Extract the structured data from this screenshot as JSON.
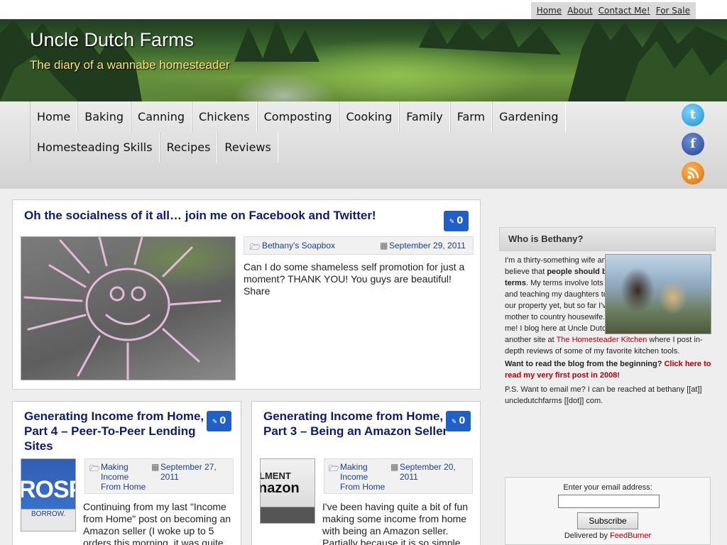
{
  "topnav": {
    "links": [
      "Home",
      "About",
      "Contact Me!",
      "For Sale"
    ]
  },
  "header": {
    "title": "Uncle Dutch Farms",
    "tagline": "The diary of a wannabe homesteader"
  },
  "nav": {
    "items": [
      "Home",
      "Baking",
      "Canning",
      "Chickens",
      "Composting",
      "Cooking",
      "Family",
      "Farm",
      "Gardening",
      "Homesteading Skills",
      "Recipes",
      "Reviews"
    ]
  },
  "social": {
    "icons": [
      "twitter-icon",
      "facebook-icon",
      "rss-icon"
    ]
  },
  "posts": [
    {
      "title": "Oh the socialness of it all… join me on Facebook and Twitter!",
      "comments": "0",
      "category": "Bethany's Soapbox",
      "date": "September 29, 2011",
      "excerpt": "Can I do some shameless self promotion for just a moment?    THANK YOU!  You guys are beautiful! Share"
    },
    {
      "title": "Generating Income from Home, Part 4 – Peer-To-Peer Lending Sites",
      "comments": "0",
      "category": "Making Income From Home",
      "date": "September 27, 2011",
      "thumb_text": "ROSP",
      "thumb_text2": "BORROW.",
      "excerpt": "Continuing from my last \"Income from Home\" post on becoming an Amazon seller (I woke up to 5 orders this morning, it was quite nice), we'll talk"
    },
    {
      "title": "Generating Income from Home, Part 3 – Being an Amazon Seller",
      "comments": "0",
      "category": "Making Income From Home",
      "date": "September 20, 2011",
      "thumb_text": "LMENT",
      "thumb_text2": "nazon",
      "excerpt": "I've been having quite a bit of fun making some income from home with being an Amazon seller. Partially because it is so simple and it takes"
    }
  ],
  "sidebar": {
    "widget_title": "Who is Bethany?",
    "bio_intro": "I'm a thirty-something wife and mother of two and I firmly believe that ",
    "bio_bold": "people should be living life on their own terms",
    "bio_mid": ". My terms involve lots of domestic things, animals, and teaching my daughters to drive a tractor. We're not on our property yet, but so far I've made it from working city mother to country housewife. Follow along my journey with me! I blog here at Uncle Dutch Farms and I also have another site at ",
    "bio_link": "The Homesteader Kitchen",
    "bio_end": " where I post in-depth reviews of some of my favorite kitchen tools.",
    "beginning_q": "Want to read the blog from the beginning? ",
    "beginning_link": "Click here to read my very first post in 2008!",
    "ps": "P.S. Want to email me? I can be reached at bethany [[at]] uncledutchfarms [[dot]] com.",
    "subscribe_label": "Enter your email address:",
    "subscribe_button": "Subscribe",
    "delivered_by": "Delivered by ",
    "feedburner": "FeedBurner"
  },
  "colors": {
    "title_blue": "#0d1b6e",
    "badge_blue": "#1e60c8",
    "link_red": "#b8000a",
    "tagline_yellow": "#ffe96b"
  }
}
